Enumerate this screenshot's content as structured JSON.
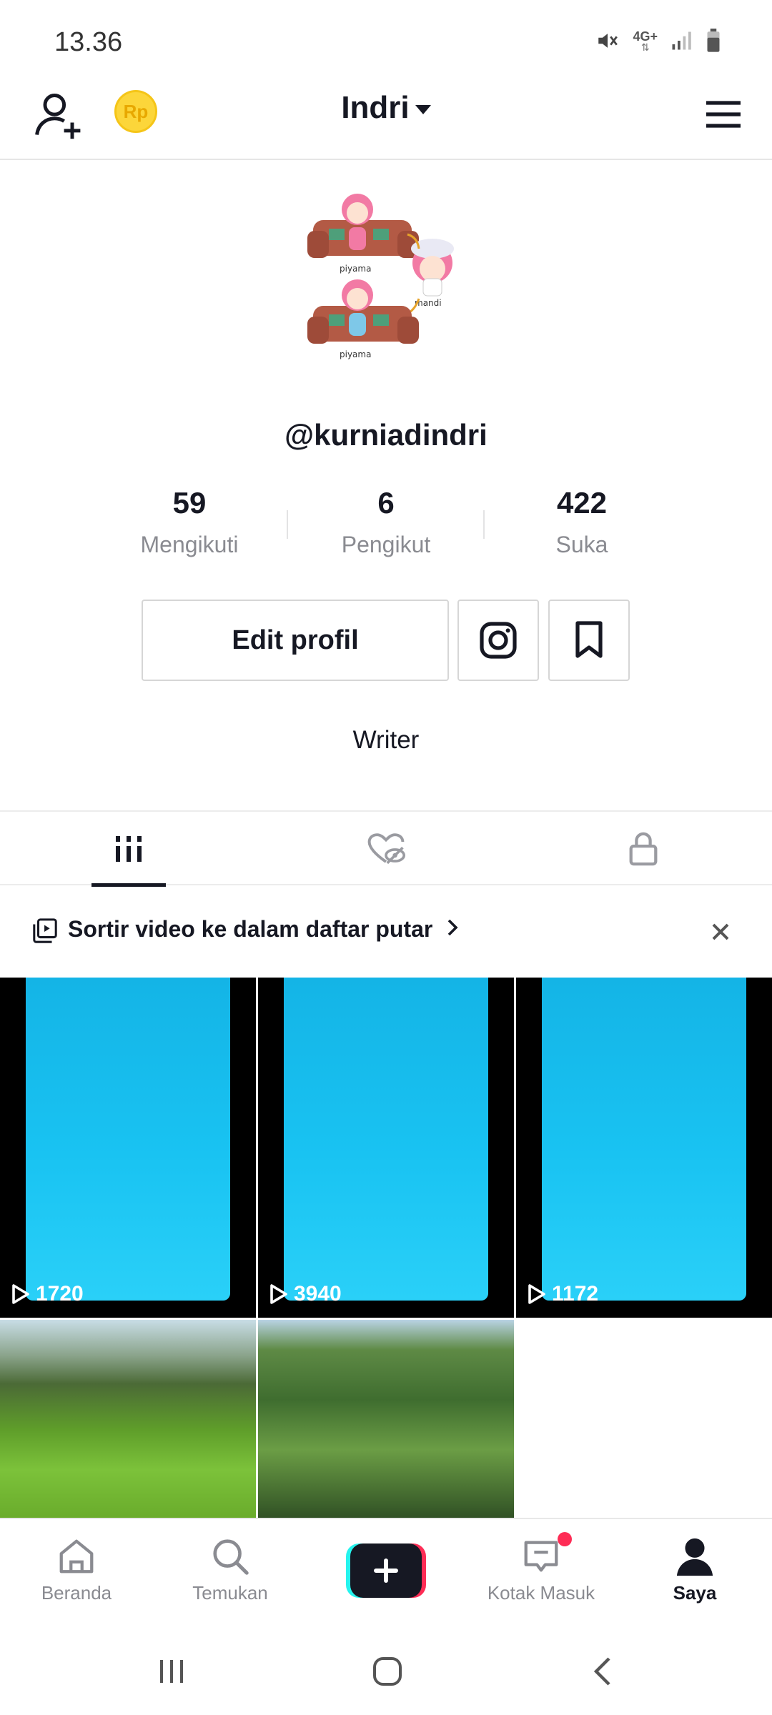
{
  "status_bar": {
    "time": "13.36",
    "network": "4G+"
  },
  "header": {
    "account_name": "Indri",
    "coin_label": "Rp"
  },
  "profile": {
    "handle": "@kurniadindri",
    "bio": "Writer"
  },
  "stats": [
    {
      "value": "59",
      "label": "Mengikuti"
    },
    {
      "value": "6",
      "label": "Pengikut"
    },
    {
      "value": "422",
      "label": "Suka"
    }
  ],
  "buttons": {
    "edit_profile": "Edit profil"
  },
  "tabs": [
    "videos",
    "liked",
    "private"
  ],
  "playlist_banner": {
    "text": "Sortir video ke dalam daftar putar"
  },
  "videos": [
    {
      "views": "1720"
    },
    {
      "views": "3940"
    },
    {
      "views": "1172"
    },
    {
      "views": ""
    },
    {
      "views": ""
    }
  ],
  "bottom_nav": [
    {
      "label": "Beranda",
      "icon": "home-icon"
    },
    {
      "label": "Temukan",
      "icon": "search-icon"
    },
    {
      "label": "",
      "icon": "create-icon"
    },
    {
      "label": "Kotak Masuk",
      "icon": "inbox-icon"
    },
    {
      "label": "Saya",
      "icon": "profile-icon",
      "active": true
    }
  ],
  "colors": {
    "accent_red": "#fe2c55",
    "accent_cyan": "#25f4ee",
    "text": "#161823",
    "muted": "#8a8b91"
  }
}
